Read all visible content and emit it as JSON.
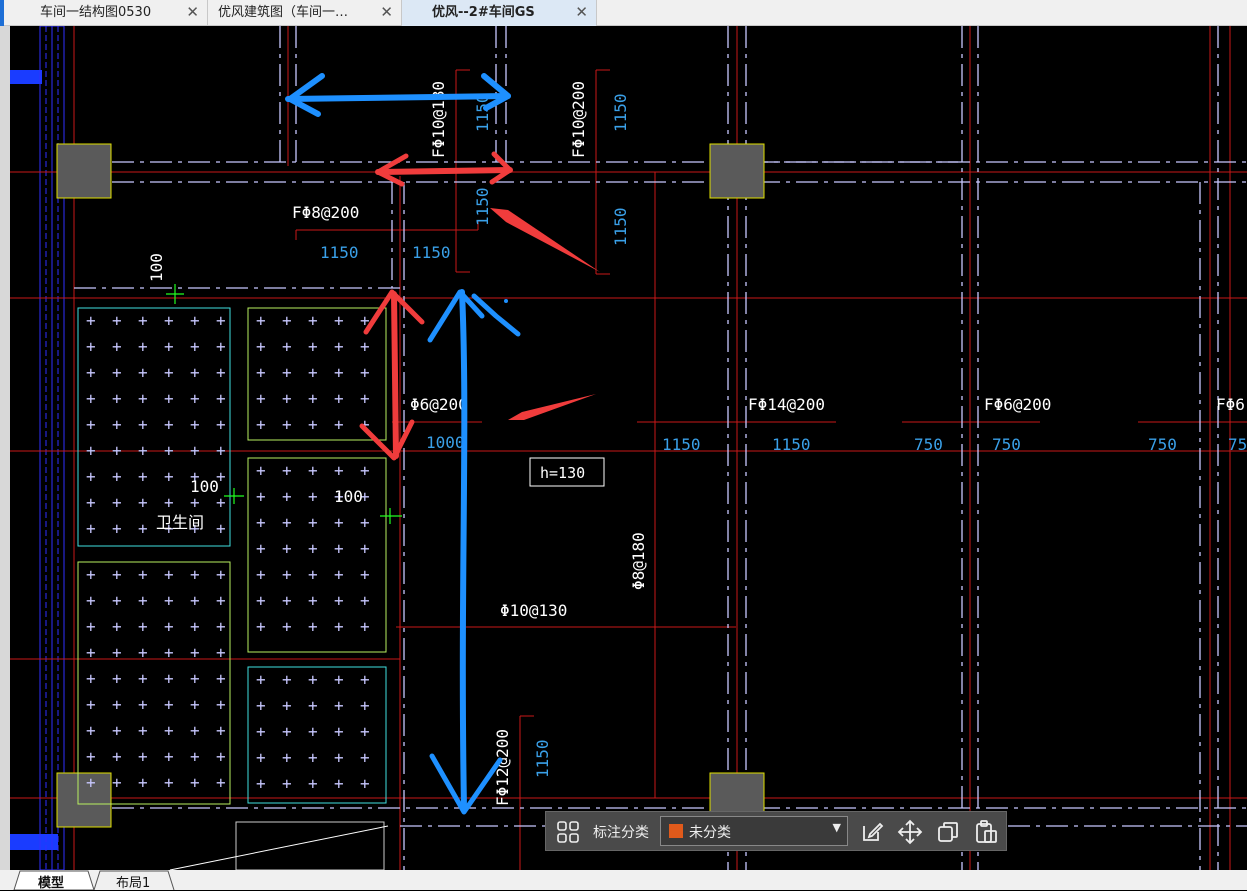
{
  "tabs": [
    {
      "label": "车间一结构图0530",
      "close": "✕"
    },
    {
      "label": "优风建筑图（车间一…",
      "close": "✕"
    },
    {
      "label": "优风--2#车间GS",
      "close": "✕"
    }
  ],
  "drawing": {
    "rebar_labels": {
      "top1": "FΦ10@180",
      "top2": "FΦ10@200",
      "mid": "FΦ8@200",
      "slab": "Φ6@200",
      "f14": "FΦ14@200",
      "f6": "FΦ6@200",
      "f6_partial": "FΦ6",
      "vertical": "Φ8@180",
      "bottom": "Φ10@130",
      "lower": "FΦ12@200"
    },
    "dims": {
      "d1150": "1150",
      "d1000": "1000",
      "d750": "750",
      "d100": "100",
      "d75": "75"
    },
    "room": "卫生间",
    "thickness": "h=130"
  },
  "toolbar": {
    "category_label": "标注分类",
    "category_value": "未分类",
    "category_color": "#e05a1b"
  },
  "layout_tabs": [
    "模型",
    "布局1"
  ],
  "colors": {
    "cad_bg": "#000000",
    "red_line": "#d01c1c",
    "dim_blue": "#3aa0e8",
    "annot_blue": "#1e90ff",
    "annot_red": "#f03c3c",
    "column": "#5a5a5a"
  }
}
